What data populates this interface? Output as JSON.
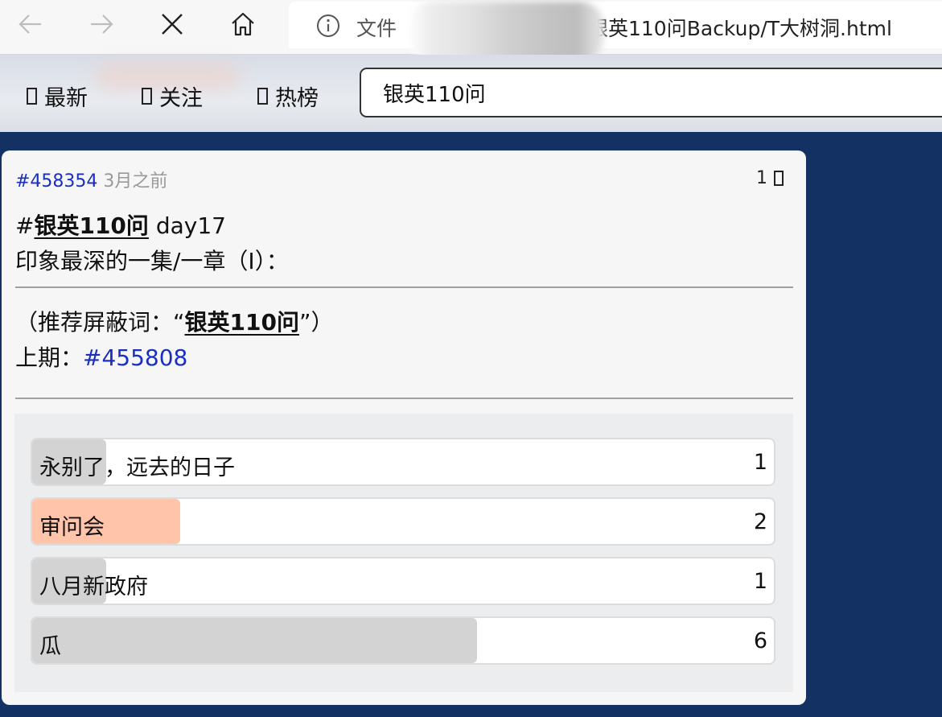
{
  "browser": {
    "scheme_label": "文件",
    "url_visible": "银英110问Backup/T大树洞.html"
  },
  "toolbar": {
    "tabs": [
      "最新",
      "关注",
      "热榜"
    ],
    "search_value": "银英110问"
  },
  "post": {
    "id": "#458354",
    "time": "3月之前",
    "like_count": "1",
    "hash_prefix": "#",
    "tag": "银英110问",
    "title_suffix": " day17",
    "line2": "印象最深的一集/一章（Ⅰ）：",
    "recommend_prefix": "（推荐屏蔽词：“",
    "recommend_word": "银英110问",
    "recommend_suffix": "”）",
    "prev_label": "上期：",
    "prev_link": "#455808"
  },
  "poll": {
    "options": [
      {
        "label": "永别了，远去的日子",
        "count": "1",
        "share": 0.1,
        "color": "#d3d3d3"
      },
      {
        "label": "审问会",
        "count": "2",
        "share": 0.2,
        "color": "#ffc4aa"
      },
      {
        "label": "八月新政府",
        "count": "1",
        "share": 0.1,
        "color": "#d3d3d3"
      },
      {
        "label": "瓜",
        "count": "6",
        "share": 0.6,
        "color": "#d3d3d3"
      }
    ]
  }
}
